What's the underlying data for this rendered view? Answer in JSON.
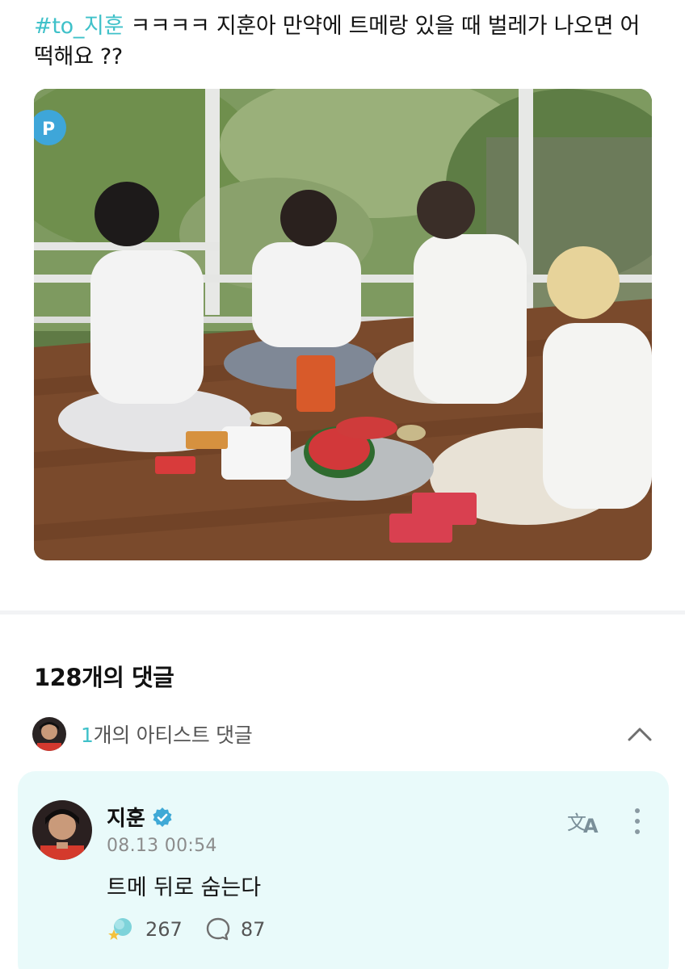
{
  "post": {
    "hashtag": "#to_지훈",
    "text": " ㅋㅋㅋㅋ 지훈아 만약에 트메랑 있을 때 벌레가 나오면 어떡해요 ??",
    "image_icon": "group-photo-watermelon-picnic"
  },
  "comments": {
    "header": "128개의 댓글",
    "artist_summary": {
      "count": "1",
      "label": "개의 아티스트 댓글",
      "toggle_icon": "chevron-up-icon"
    },
    "artist_comment": {
      "author": "지훈",
      "verified_icon": "verified-badge-icon",
      "timestamp": "08.13 00:54",
      "body": "트메 뒤로 숨는다",
      "likes": "267",
      "replies": "87",
      "translate_icon": "translate-icon",
      "more_icon": "more-vertical-icon"
    }
  },
  "colors": {
    "accent": "#3fc1c9",
    "card_bg": "#e9fafa",
    "muted": "#8c8c8c"
  }
}
